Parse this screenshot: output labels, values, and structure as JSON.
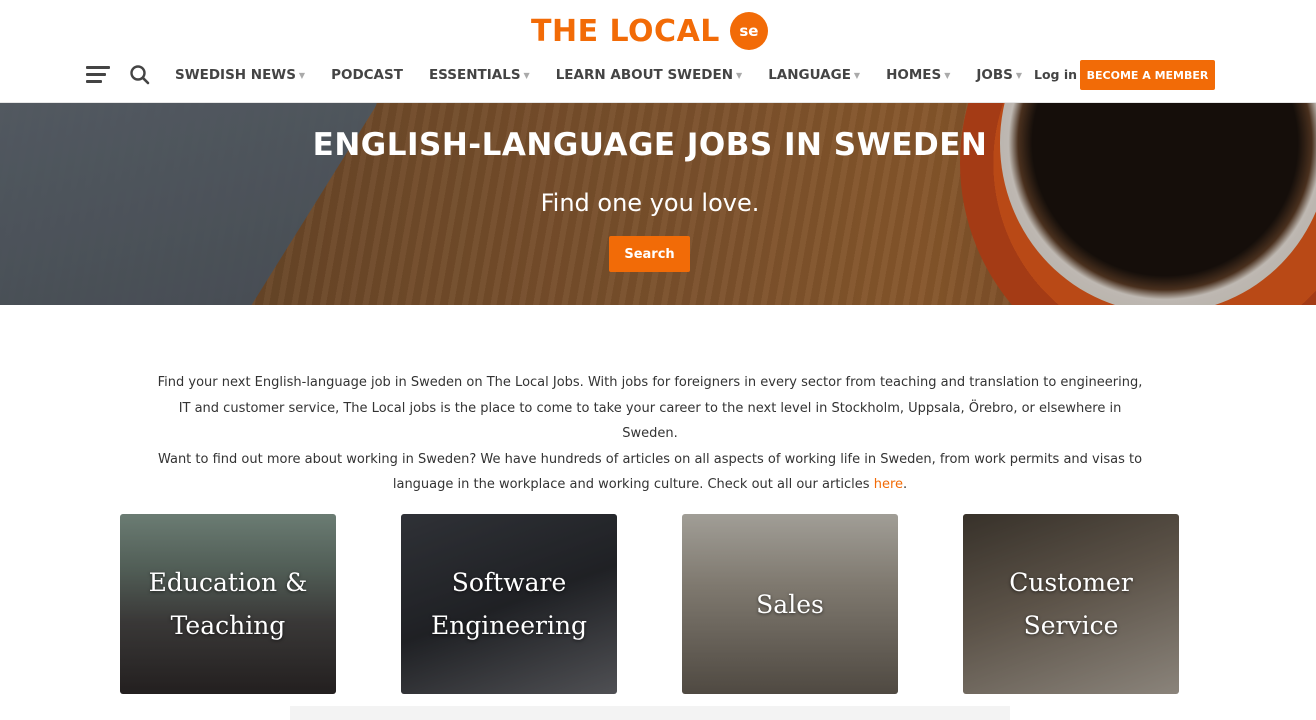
{
  "brand": {
    "name": "THE LOCAL",
    "badge": "se"
  },
  "nav": {
    "items": [
      {
        "label": "SWEDISH NEWS",
        "has_dropdown": true
      },
      {
        "label": "PODCAST",
        "has_dropdown": false
      },
      {
        "label": "ESSENTIALS",
        "has_dropdown": true
      },
      {
        "label": "LEARN ABOUT SWEDEN",
        "has_dropdown": true
      },
      {
        "label": "LANGUAGE",
        "has_dropdown": true
      },
      {
        "label": "HOMES",
        "has_dropdown": true
      },
      {
        "label": "JOBS",
        "has_dropdown": true
      }
    ],
    "login_label": "Log in",
    "member_label": "BECOME A MEMBER"
  },
  "hero": {
    "title": "ENGLISH-LANGUAGE JOBS IN SWEDEN",
    "subtitle": "Find one you love.",
    "search_label": "Search"
  },
  "intro": {
    "para1": "Find your next English-language job in Sweden on The Local Jobs. With jobs for foreigners in every sector from teaching and translation to engineering, IT and customer service, The Local jobs is the place to come to take your career to the next level in Stockholm, Uppsala, Örebro, or elsewhere in Sweden.",
    "para2_before": "Want to find out more about working in Sweden? We have hundreds of articles on all aspects of working life in Sweden, from work permits and visas to language in the workplace and working culture. Check out all our articles ",
    "para2_link": "here",
    "para2_after": "."
  },
  "categories": [
    {
      "label": "Education & Teaching"
    },
    {
      "label": "Software Engineering"
    },
    {
      "label": "Sales"
    },
    {
      "label": "Customer Service"
    }
  ],
  "colors": {
    "accent": "#f26b07",
    "text": "#333333"
  }
}
